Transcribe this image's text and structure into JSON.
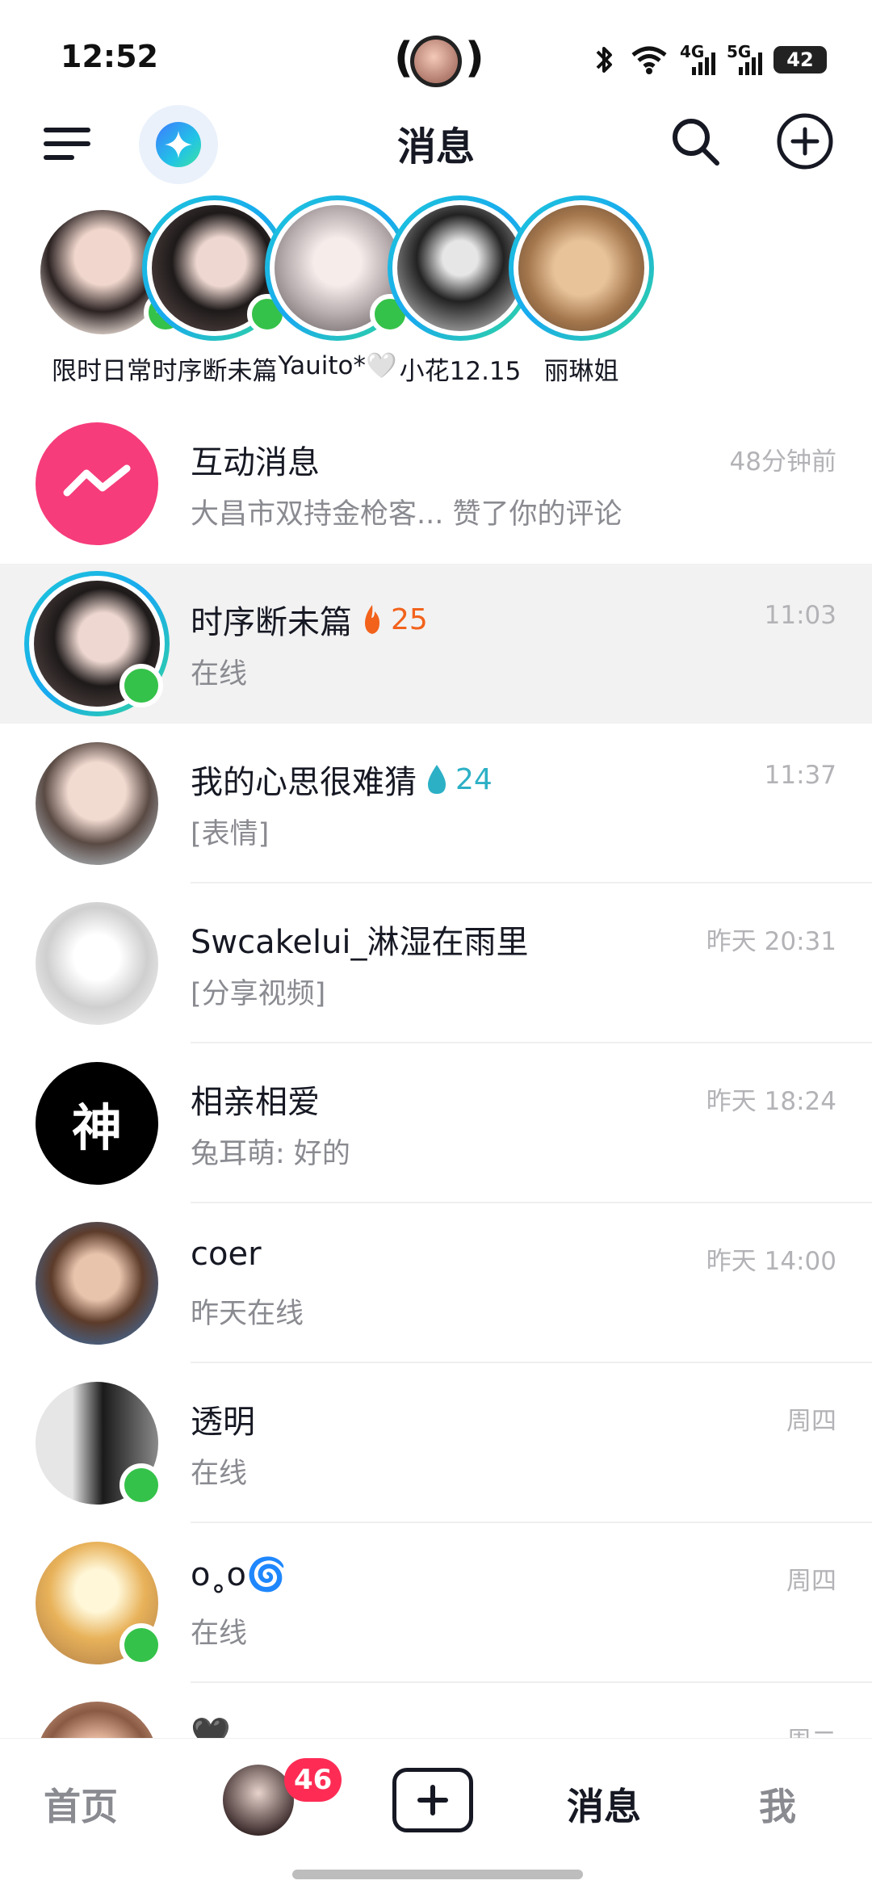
{
  "status_bar": {
    "time": "12:52",
    "battery": "42",
    "network_1": "4G",
    "network_2": "5G"
  },
  "header": {
    "title": "消息",
    "icons": [
      "menu-icon",
      "ai-assistant-icon",
      "search-icon",
      "add-circle-icon"
    ]
  },
  "stories": [
    {
      "name": "限时日常",
      "type": "self",
      "badge": "plus"
    },
    {
      "name": "时序断未篇",
      "type": "ring",
      "online": true
    },
    {
      "name": "Yauito*🤍",
      "type": "ring",
      "online": true
    },
    {
      "name": "小花12.15",
      "type": "ring",
      "online": false
    },
    {
      "name": "丽琳姐",
      "type": "ring",
      "online": false
    }
  ],
  "conversations": [
    {
      "name": "互动消息",
      "preview": "大昌市双持金枪客... 赞了你的评论",
      "time": "48分钟前"
    },
    {
      "name": "时序断未篇",
      "streak": "25",
      "streak_type": "fire",
      "preview": "在线",
      "time": "11:03",
      "online": true,
      "highlighted": true
    },
    {
      "name": "我的心思很难猜",
      "streak": "24",
      "streak_type": "water",
      "preview": "[表情]",
      "time": "11:37"
    },
    {
      "name": "Swcakelui_淋湿在雨里",
      "preview": "[分享视频]",
      "time": "昨天 20:31"
    },
    {
      "name": "相亲相爱",
      "avatar_text": "神",
      "preview": "兔耳萌: 好的",
      "time": "昨天 18:24"
    },
    {
      "name": "coer",
      "preview": "昨天在线",
      "time": "昨天 14:00"
    },
    {
      "name": "透明",
      "preview": "在线",
      "time": "周四",
      "online": true
    },
    {
      "name": "o˳o🌀",
      "preview": "在线",
      "time": "周四",
      "online": true
    },
    {
      "name": "🖤",
      "preview": "",
      "time": "周二"
    }
  ],
  "tabbar": {
    "home": "首页",
    "badge": "46",
    "messages": "消息",
    "me": "我"
  },
  "colors": {
    "online": "#35c24a",
    "badge": "#fe2c55",
    "interact": "#f63c7a",
    "ring_start": "#1ec7d8",
    "ring_end": "#32d79a"
  }
}
